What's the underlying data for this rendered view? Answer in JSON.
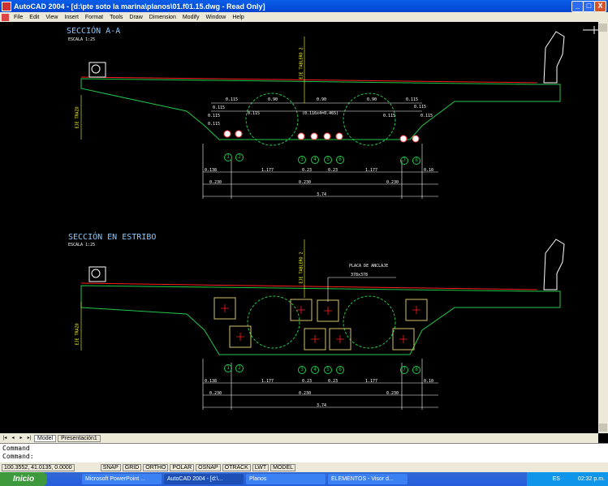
{
  "window": {
    "title": "AutoCAD 2004 - [d:\\pte soto la marina\\planos\\01.f01.15.dwg - Read Only]",
    "buttons": [
      "_",
      "□",
      "X"
    ]
  },
  "menu": [
    "File",
    "Edit",
    "View",
    "Insert",
    "Format",
    "Tools",
    "Draw",
    "Dimension",
    "Modify",
    "Window",
    "Help"
  ],
  "drawing": {
    "section_a": {
      "title": "SECCIÓN  A-A",
      "scale": "ESCALA 1:25",
      "axis_labels": [
        "EJE TABLERO 2",
        "EJE TRAZO"
      ],
      "dims_top": [
        "0.115",
        "0.90",
        "0.90",
        "0.90",
        "0.115"
      ],
      "dims_mid": [
        "0.115",
        "0.115",
        "(0.116x4=0.465)",
        "0.115"
      ],
      "dims_left": [
        "0.115",
        "0.115"
      ],
      "dims_right": [
        "0.115",
        "0.115"
      ],
      "markers": [
        "1",
        "2",
        "3",
        "4",
        "5",
        "6",
        "7",
        "8"
      ],
      "dim_row1": [
        "0.138",
        "1.177",
        "0.23",
        "0.23",
        "1.177",
        "0.10"
      ],
      "dim_row2": [
        "0.230",
        "0.230",
        "0.230"
      ],
      "dim_total": "3.74"
    },
    "section_b": {
      "title": "SECCIÓN  EN  ESTRIBO",
      "scale": "ESCALA 1:25",
      "axis_labels": [
        "EJE TABLERO 2",
        "EJE TRAZO"
      ],
      "plate_label": "PLACA DE ANCLAJE",
      "plate_size": "378x378",
      "markers": [
        "1",
        "2",
        "3",
        "4",
        "5",
        "6",
        "7",
        "8"
      ],
      "dim_row1": [
        "0.138",
        "1.177",
        "0.23",
        "0.23",
        "1.177",
        "0.10"
      ],
      "dim_row2": [
        "0.230",
        "0.230",
        "0.230"
      ],
      "dim_total": "3.74"
    }
  },
  "tabs": [
    "Model",
    "Presentación1"
  ],
  "command": {
    "prompt": "Command",
    "line": "Command:"
  },
  "status": {
    "coords": "100.3552, 41.0135, 0.0000",
    "toggles": [
      "SNAP",
      "GRID",
      "ORTHO",
      "POLAR",
      "OSNAP",
      "OTRACK",
      "LWT",
      "MODEL"
    ]
  },
  "taskbar": {
    "start": "Inicio",
    "items": [
      "Microsoft PowerPoint ...",
      "AutoCAD 2004 - [d:\\...",
      "Planos",
      "ELEMENTOS - Visor d..."
    ],
    "lang": "ES",
    "time": "02:32 p.m."
  },
  "colors": {
    "drawing_bg": "#000000",
    "outline": "#22c84a",
    "dim_lines": "#ffffff",
    "title_text": "#88c8ff",
    "axis_text": "#ffff33",
    "markers": "#22c84a",
    "plates": "#d4c46a",
    "accent_red": "#ff2020"
  }
}
